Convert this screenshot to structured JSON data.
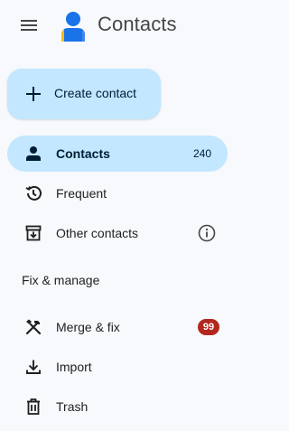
{
  "header": {
    "menu_icon": "hamburger-menu-icon",
    "logo_icon": "contacts-person-logo",
    "title": "Contacts"
  },
  "create_button": {
    "icon": "plus-icon",
    "label": "Create contact",
    "color": "#c2e7ff"
  },
  "nav": {
    "items": [
      {
        "label": "Contacts",
        "icon": "person-icon",
        "count": "240",
        "active": true
      },
      {
        "label": "Frequent",
        "icon": "history-icon"
      },
      {
        "label": "Other contacts",
        "icon": "archive-download-icon",
        "trailing_icon": "info-icon"
      }
    ]
  },
  "fix_manage": {
    "heading": "Fix & manage",
    "items": [
      {
        "label": "Merge & fix",
        "icon": "tools-icon",
        "badge": "99",
        "badge_color": "#b3261e"
      },
      {
        "label": "Import",
        "icon": "download-icon"
      },
      {
        "label": "Trash",
        "icon": "trash-icon"
      }
    ]
  },
  "colors": {
    "background": "#f7f9fd",
    "accent": "#c2e7ff",
    "logo_blue": "#1a73e8"
  }
}
